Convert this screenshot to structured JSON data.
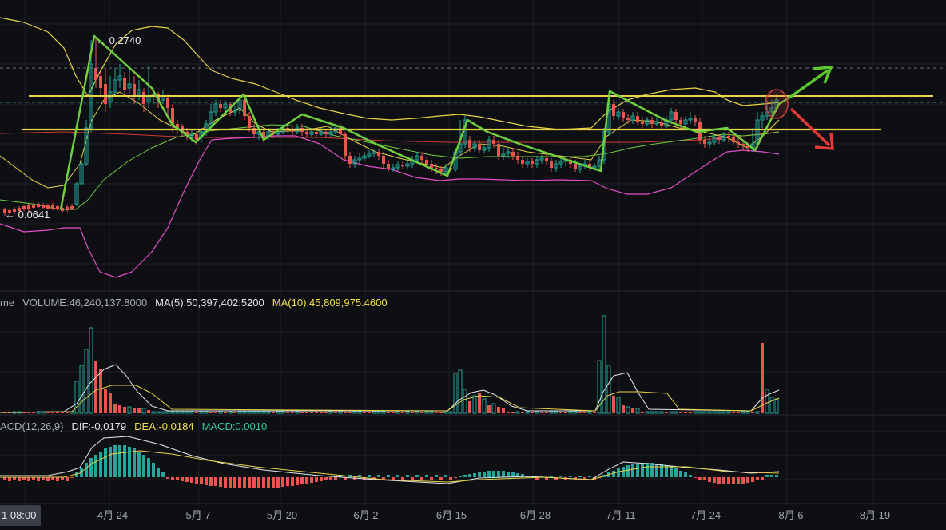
{
  "chart_data": {
    "type": "candlestick",
    "price_panel": {
      "high_label": "← 0.2740",
      "low_label": "← 0.0641",
      "high_value": 0.274,
      "low_value": 0.0641,
      "support_line": "yellow",
      "resistance_line": "yellow",
      "projection_up_color": "#5cc82e",
      "projection_down_color": "#e53935",
      "pattern_color": "#5cc82e"
    },
    "volume_panel": {
      "label": "me",
      "volume": "VOLUME:46,240,137.8000",
      "ma5": "MA(5):50,397,402.5200",
      "ma10": "MA(10):45,809,975.4600"
    },
    "macd_panel": {
      "label": "ACD(12,26,9)",
      "dif": "DIF:-0.0179",
      "dea": "DEA:-0.0184",
      "macd": "MACD:0.0010"
    },
    "x_axis": {
      "current_tag": "1 08:00",
      "ticks": [
        "4月 24",
        "5月 7",
        "5月 20",
        "6月 2",
        "6月 15",
        "6月 28",
        "7月 11",
        "7月 24",
        "8月 6",
        "8月 19"
      ]
    },
    "colors": {
      "up": "#26a69a",
      "down": "#ef5350",
      "upper_band": "#e8d34a",
      "lower_band": "#e04fc9",
      "mid_band": "#6fcf3f",
      "ma_red": "#d23b3b"
    }
  }
}
